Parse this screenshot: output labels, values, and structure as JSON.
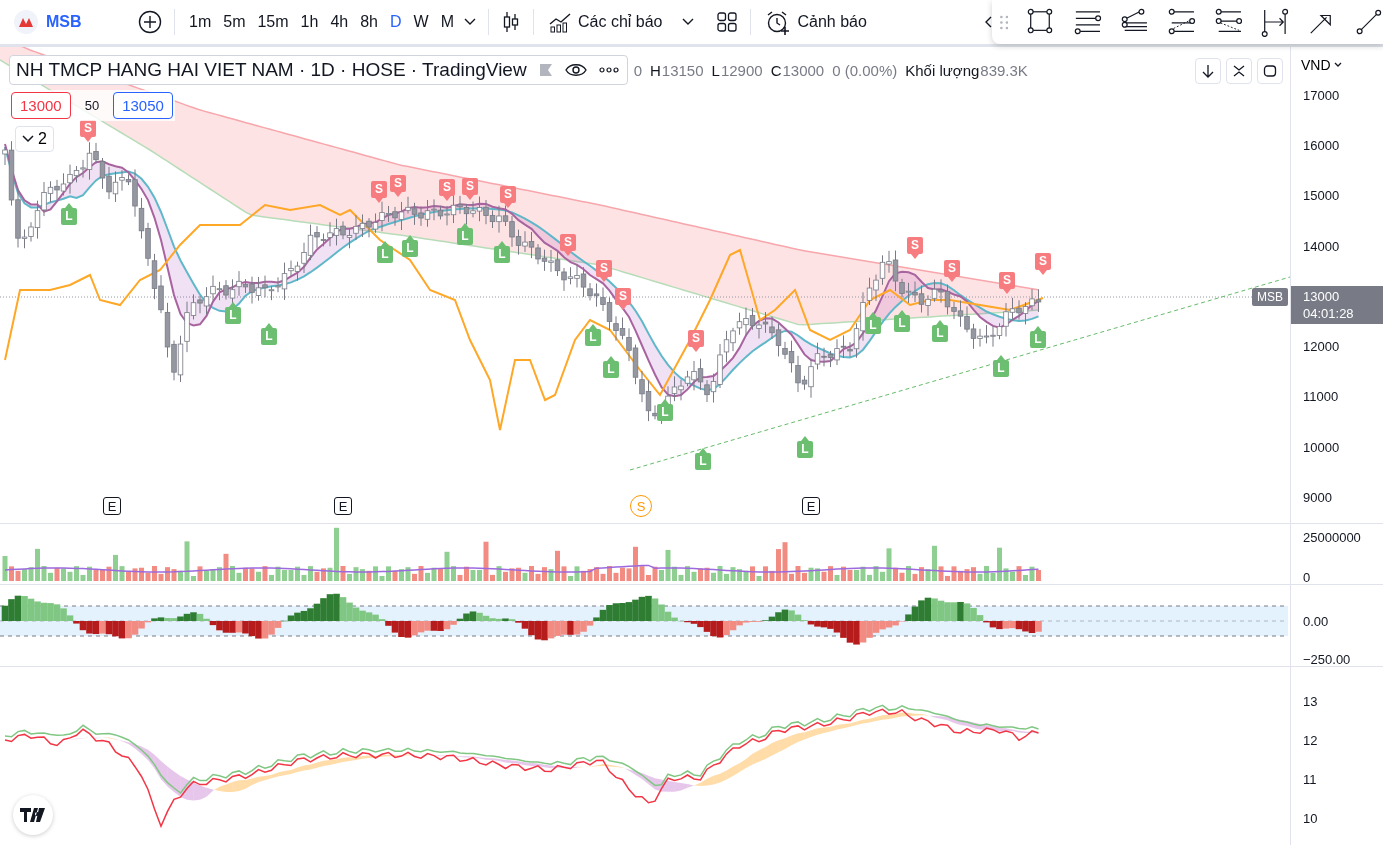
{
  "toolbar": {
    "symbol": "MSB",
    "intervals": [
      {
        "label": "1m",
        "selected": false
      },
      {
        "label": "5m",
        "selected": false
      },
      {
        "label": "15m",
        "selected": false
      },
      {
        "label": "1h",
        "selected": false
      },
      {
        "label": "4h",
        "selected": false
      },
      {
        "label": "8h",
        "selected": false
      },
      {
        "label": "D",
        "selected": true
      },
      {
        "label": "W",
        "selected": false
      },
      {
        "label": "M",
        "selected": false
      }
    ],
    "indicators_label": "Các chỉ báo",
    "alerts_label": "Cảnh báo"
  },
  "legend": {
    "title": "NH TMCP HANG HAI VIET NAM · 1D · HOSE · TradingView",
    "values": [
      {
        "value": "0"
      },
      {
        "label": "H",
        "value": "13150"
      },
      {
        "label": "L",
        "value": "12900"
      },
      {
        "label": "C",
        "value": "13000"
      },
      {
        "value": "0 (0.00%)"
      },
      {
        "label": "Khối lượng",
        "value": "839.3K"
      }
    ],
    "sell_price": "13000",
    "spread": "50",
    "buy_price": "13050",
    "hidden_count": "2"
  },
  "currency": "VND",
  "price_axis": [
    "17000",
    "16000",
    "15000",
    "14000",
    "12000",
    "11000",
    "10000",
    "9000"
  ],
  "last_price": {
    "symbol": "MSB",
    "price": "13000",
    "countdown": "04:01:28"
  },
  "signals": [
    {
      "kind": "sell",
      "label": "S"
    },
    {
      "kind": "sell",
      "label": "S"
    },
    {
      "kind": "sell",
      "label": "S"
    },
    {
      "kind": "sell",
      "label": "S"
    },
    {
      "kind": "sell",
      "label": "S"
    },
    {
      "kind": "sell",
      "label": "S"
    },
    {
      "kind": "sell",
      "label": "S"
    },
    {
      "kind": "sell",
      "label": "S"
    },
    {
      "kind": "sell",
      "label": "S"
    },
    {
      "kind": "sell",
      "label": "S"
    },
    {
      "kind": "sell",
      "label": "S"
    },
    {
      "kind": "sell",
      "label": "S"
    },
    {
      "kind": "sell",
      "label": "S"
    },
    {
      "kind": "sell",
      "label": "S"
    },
    {
      "kind": "buy",
      "label": "L"
    },
    {
      "kind": "buy",
      "label": "L"
    },
    {
      "kind": "buy",
      "label": "L"
    },
    {
      "kind": "buy",
      "label": "L"
    },
    {
      "kind": "buy",
      "label": "L"
    },
    {
      "kind": "buy",
      "label": "L"
    },
    {
      "kind": "buy",
      "label": "L"
    },
    {
      "kind": "buy",
      "label": "L"
    },
    {
      "kind": "buy",
      "label": "L"
    },
    {
      "kind": "buy",
      "label": "L"
    },
    {
      "kind": "buy",
      "label": "L"
    },
    {
      "kind": "buy",
      "label": "L"
    },
    {
      "kind": "buy",
      "label": "L"
    },
    {
      "kind": "buy",
      "label": "L"
    },
    {
      "kind": "buy",
      "label": "L"
    },
    {
      "kind": "buy",
      "label": "L"
    },
    {
      "kind": "buy",
      "label": "L"
    }
  ],
  "events": [
    {
      "kind": "earnings",
      "label": "E"
    },
    {
      "kind": "earnings",
      "label": "E"
    },
    {
      "kind": "split",
      "label": "S"
    },
    {
      "kind": "earnings",
      "label": "E"
    }
  ],
  "volume_axis": [
    "25000000",
    "0"
  ],
  "oscillator_axis": [
    "0.00",
    "−250.00"
  ],
  "lower_axis": [
    "13",
    "12",
    "11",
    "10"
  ]
}
